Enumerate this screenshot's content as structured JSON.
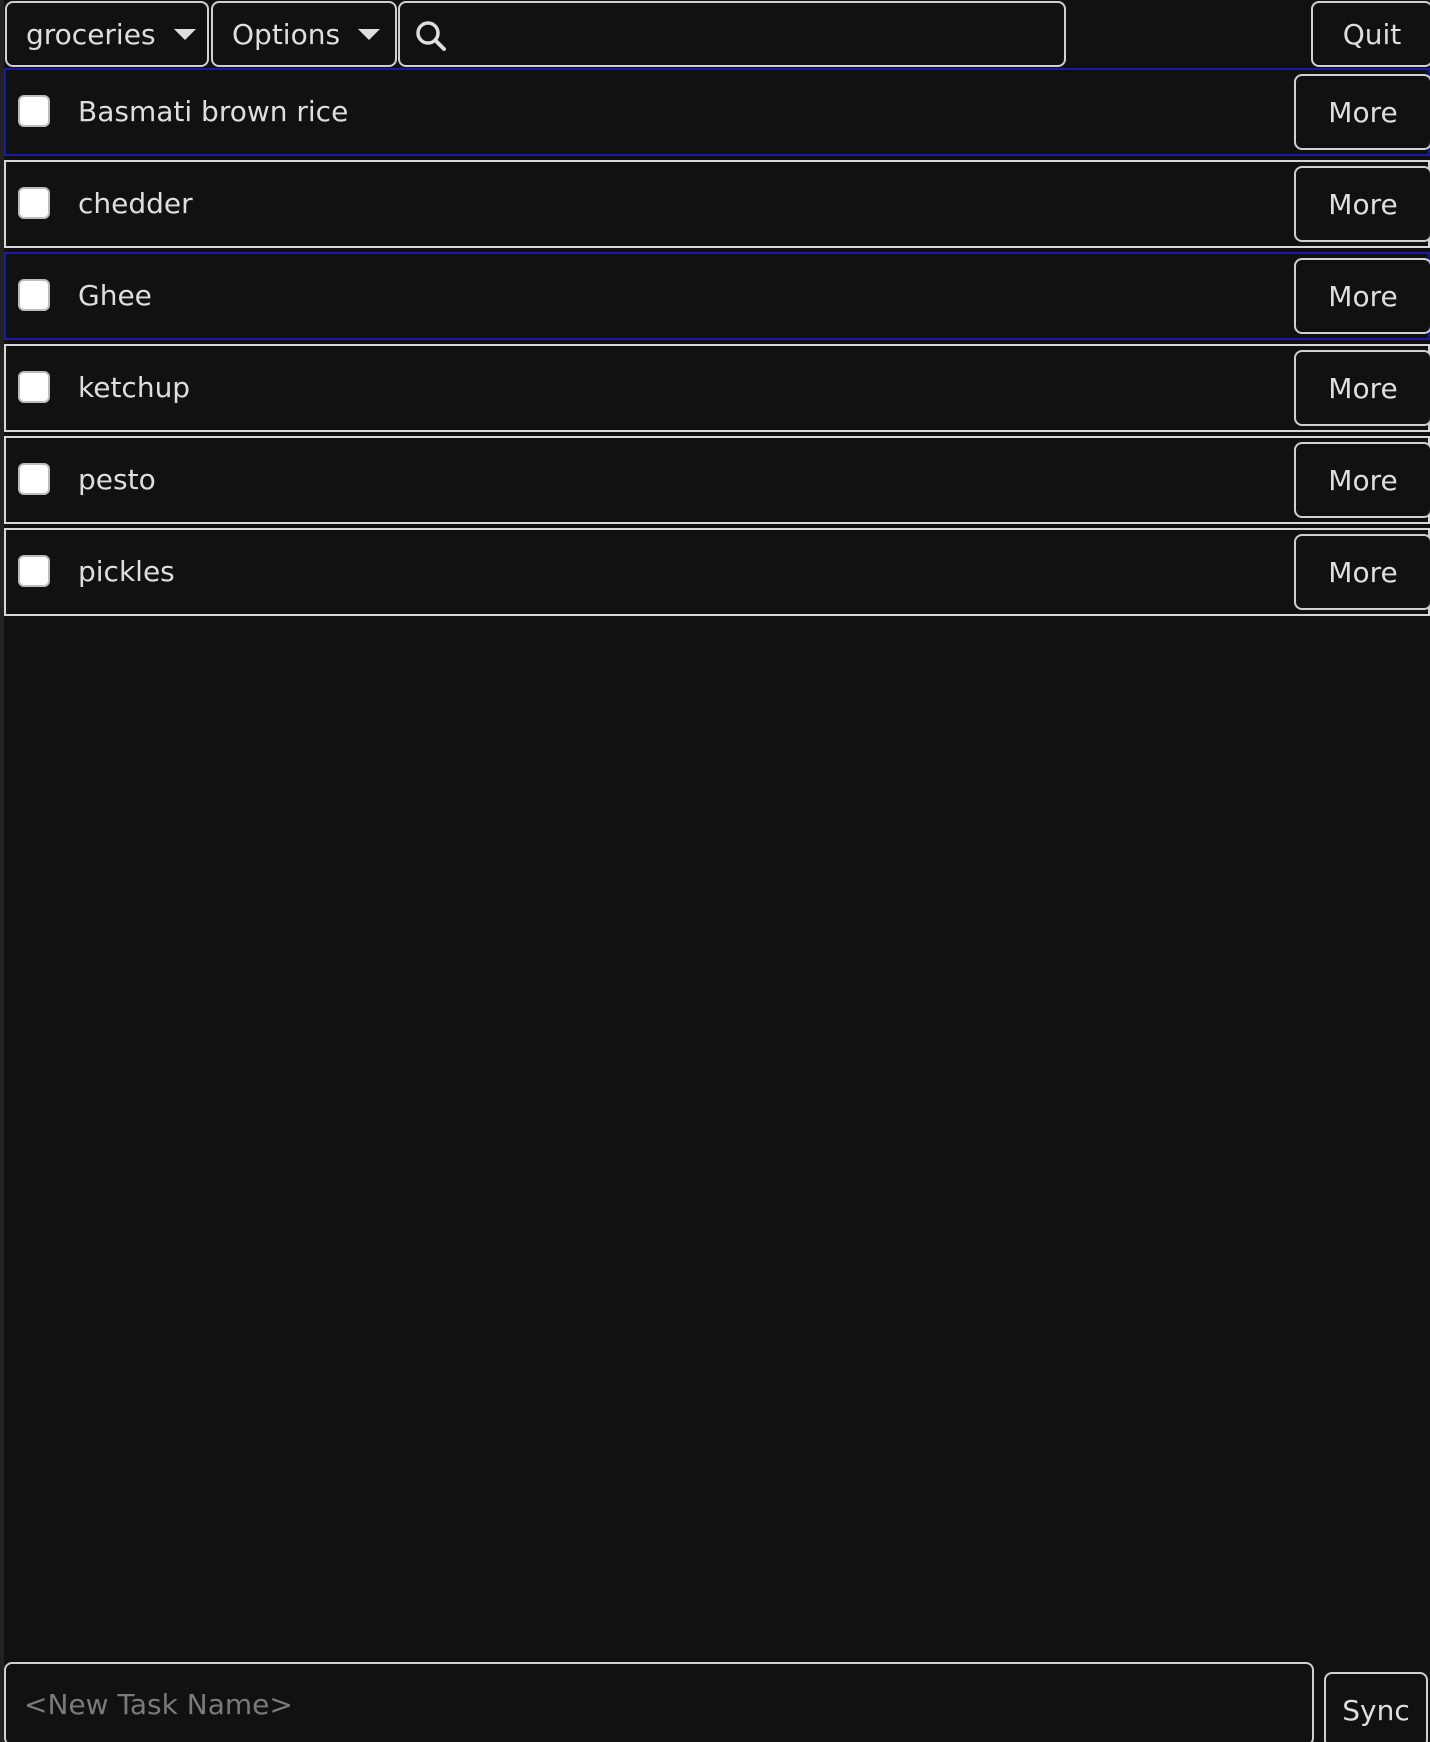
{
  "toolbar": {
    "list_selector_label": "groceries",
    "options_label": "Options",
    "search_value": "",
    "quit_label": "Quit"
  },
  "tasks": [
    {
      "label": "Basmati brown rice",
      "checked": false,
      "focused": true,
      "more_label": "More"
    },
    {
      "label": "chedder",
      "checked": false,
      "focused": false,
      "more_label": "More"
    },
    {
      "label": "Ghee",
      "checked": false,
      "focused": true,
      "more_label": "More"
    },
    {
      "label": "ketchup",
      "checked": false,
      "focused": false,
      "more_label": "More"
    },
    {
      "label": "pesto",
      "checked": false,
      "focused": false,
      "more_label": "More"
    },
    {
      "label": "pickles",
      "checked": false,
      "focused": false,
      "more_label": "More"
    }
  ],
  "footer": {
    "new_task_placeholder": "<New Task Name>",
    "sync_label": "Sync"
  },
  "colors": {
    "background": "#111111",
    "border": "#d8d8d8",
    "focus_border": "#1a1aa8",
    "text": "#dedede",
    "placeholder": "#7a7a7a"
  },
  "icons": {
    "search": "search-icon",
    "dropdown": "caret-down-icon"
  }
}
